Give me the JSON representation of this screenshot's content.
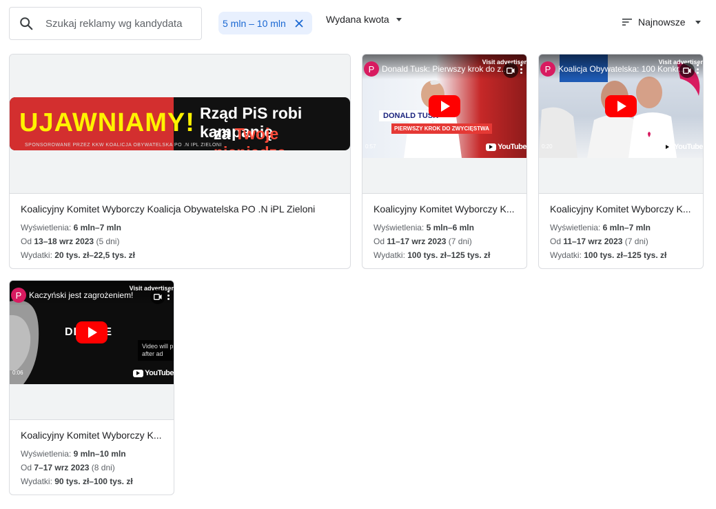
{
  "search": {
    "placeholder": "Szukaj reklamy wg kandydata"
  },
  "filter_chip": {
    "label": "5 mln – 10 mln"
  },
  "spend_dropdown": {
    "label": "Wydana kwota"
  },
  "sort": {
    "label": "Najnowsze"
  },
  "cards": [
    {
      "title": "Koalicyjny Komitet Wyborczy Koalicja Obywatelska PO .N iPL Zieloni",
      "views_label": "Wyświetlenia:",
      "views": "6 mln–7 mln",
      "date_prefix": "Od",
      "dates": "13–18 wrz 2023",
      "days": "(5 dni)",
      "spend_label": "Wydatki:",
      "spend": "20 tys. zł–22,5 tys. zł",
      "banner": {
        "headline": "UJAWNIAMY!",
        "line1": "Rząd PiS robi kampanię",
        "line2_prefix": "za",
        "line2_highlight": "Twoje pieniądze",
        "sponsor": "SPONSOROWANE PRZEZ KKW KOALICJA OBYWATELSKA PO .N IPL ZIELONI"
      }
    },
    {
      "title": "Koalicyjny Komitet Wyborczy K...",
      "views_label": "Wyświetlenia:",
      "views": "5 mln–6 mln",
      "date_prefix": "Od",
      "dates": "11–17 wrz 2023",
      "days": "(7 dni)",
      "spend_label": "Wydatki:",
      "spend": "100 tys. zł–125 tys. zł",
      "video": {
        "avatar": "P",
        "title": "Donald Tusk: Pierwszy krok do z...",
        "visit": "Visit advertiser",
        "time": "0:57",
        "yt": "YouTube",
        "caption1": "DONALD TUSK",
        "caption2": "PIERWSZY KROK DO ZWYCIĘSTWA"
      }
    },
    {
      "title": "Koalicyjny Komitet Wyborczy K...",
      "views_label": "Wyświetlenia:",
      "views": "6 mln–7 mln",
      "date_prefix": "Od",
      "dates": "11–17 wrz 2023",
      "days": "(7 dni)",
      "spend_label": "Wydatki:",
      "spend": "100 tys. zł–125 tys. zł",
      "video": {
        "avatar": "P",
        "title": "Koalicja Obywatelska: 100 Konkr...",
        "visit": "Visit advertiser",
        "time": "0:20",
        "yt": "YouTube"
      }
    },
    {
      "title": "Koalicyjny Komitet Wyborczy K...",
      "views_label": "Wyświetlenia:",
      "views": "9 mln–10 mln",
      "date_prefix": "Od",
      "dates": "7–17 wrz 2023",
      "days": "(8 dni)",
      "spend_label": "Wydatki:",
      "spend": "90 tys. zł–100 tys. zł",
      "video": {
        "avatar": "P",
        "title": "Kaczyński jest zagrożeniem!",
        "visit": "Visit advertiser",
        "time": "0:06",
        "yt": "YouTube",
        "overlay_text": "DL   BIE",
        "skip_line1": "Video will play",
        "skip_line2": "after ad"
      }
    }
  ],
  "colors": {
    "chip_bg": "#e8f0fe",
    "chip_text": "#1967d2",
    "play_red": "#ff0000",
    "avatar": "#d81b60"
  }
}
